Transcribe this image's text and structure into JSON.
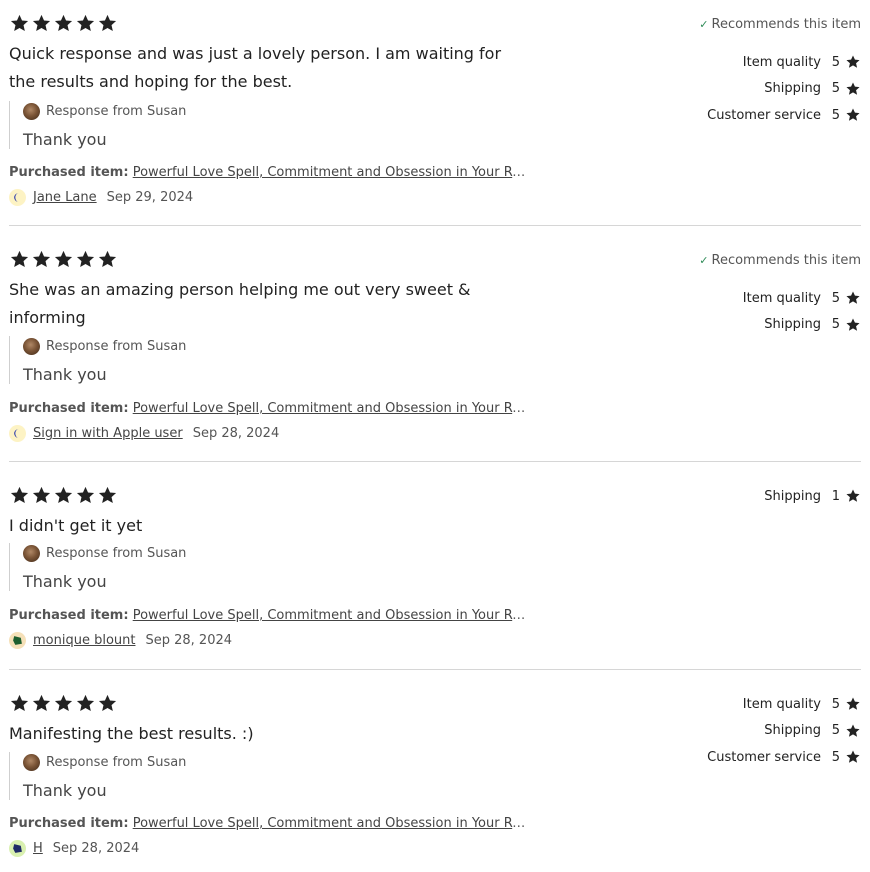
{
  "reviews": [
    {
      "rating": 5,
      "recommends": "Recommends this item",
      "text": "Quick response and was just a lovely person. I am waiting for the results and hoping for the best.",
      "response_label": "Response from Susan",
      "response_text": "Thank you",
      "purchased_label": "Purchased item:",
      "item": "Powerful Love Spell, Commitment and Obsession in Your Relationship",
      "user": "Jane Lane",
      "date": "Sep 29, 2024",
      "user_icon": "crescent-icon",
      "ratings": [
        {
          "label": "Item quality",
          "value": "5"
        },
        {
          "label": "Shipping",
          "value": "5"
        },
        {
          "label": "Customer service",
          "value": "5"
        }
      ]
    },
    {
      "rating": 5,
      "recommends": "Recommends this item",
      "text": "She was an amazing person helping me out very sweet & informing",
      "response_label": "Response from Susan",
      "response_text": "Thank you",
      "purchased_label": "Purchased item:",
      "item": "Powerful Love Spell, Commitment and Obsession in Your Relationship",
      "user": "Sign in with Apple user",
      "date": "Sep 28, 2024",
      "user_icon": "crescent-icon",
      "ratings": [
        {
          "label": "Item quality",
          "value": "5"
        },
        {
          "label": "Shipping",
          "value": "5"
        }
      ]
    },
    {
      "rating": 5,
      "recommends": "",
      "text": "I didn't get it yet",
      "response_label": "Response from Susan",
      "response_text": "Thank you",
      "purchased_label": "Purchased item:",
      "item": "Powerful Love Spell, Commitment and Obsession in Your Relationship",
      "user": "monique blount",
      "date": "Sep 28, 2024",
      "user_icon": "pentagon-icon",
      "ratings": [
        {
          "label": "Shipping",
          "value": "1"
        }
      ]
    },
    {
      "rating": 5,
      "recommends": "",
      "text": "Manifesting the best results. :)",
      "response_label": "Response from Susan",
      "response_text": "Thank you",
      "purchased_label": "Purchased item:",
      "item": "Powerful Love Spell, Commitment and Obsession in Your Relationship",
      "user": "H",
      "date": "Sep 28, 2024",
      "user_icon": "pentagon-icon",
      "ratings": [
        {
          "label": "Item quality",
          "value": "5"
        },
        {
          "label": "Shipping",
          "value": "5"
        },
        {
          "label": "Customer service",
          "value": "5"
        }
      ]
    }
  ],
  "colors": {
    "star": "#222222",
    "check": "#2e8b57",
    "crescent_bg": "#fdf3c4",
    "crescent_fg": "#2233aa",
    "pentagon_bg_1": "#f5e0b8",
    "pentagon_fg_1": "#1d5e2e",
    "pentagon_bg_2": "#d9f0b0",
    "pentagon_fg_2": "#1f2a66"
  }
}
